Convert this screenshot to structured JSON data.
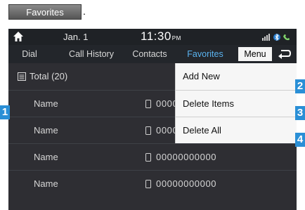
{
  "header_button": {
    "label": "Favorites",
    "trailing": "."
  },
  "status_bar": {
    "date": "Jan.  1",
    "time": "11:30",
    "ampm": "PM"
  },
  "tabs": [
    {
      "label": "Dial"
    },
    {
      "label": "Call History"
    },
    {
      "label": "Contacts"
    },
    {
      "label": "Favorites",
      "active": true
    }
  ],
  "menu_label": "Menu",
  "total_label": "Total (20)",
  "contacts": [
    {
      "name": "Name",
      "number": "00000000000"
    },
    {
      "name": "Name",
      "number": "00000000000"
    },
    {
      "name": "Name",
      "number": "00000000000"
    },
    {
      "name": "Name",
      "number": "00000000000"
    }
  ],
  "menu_items": [
    {
      "label": "Add New"
    },
    {
      "label": "Delete Items"
    },
    {
      "label": "Delete All"
    }
  ],
  "callouts": [
    "1",
    "2",
    "3",
    "4"
  ],
  "colors": {
    "screen_bg": "#2e2e33",
    "active_tab": "#5ab3f0",
    "callout": "#2a8fd6",
    "menu_bg": "#f6f6f6"
  },
  "icons": [
    "home-icon",
    "signal-icon",
    "bluetooth-icon",
    "back-arrow-icon",
    "list-icon",
    "phone-icon"
  ]
}
